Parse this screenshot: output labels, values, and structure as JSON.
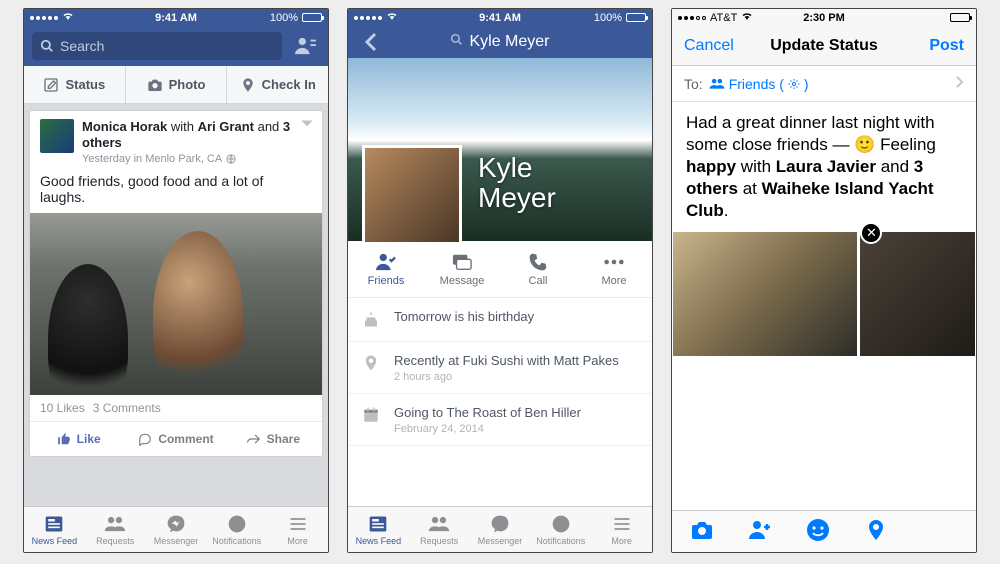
{
  "screen1": {
    "statusbar": {
      "time": "9:41 AM",
      "battery": "100%",
      "carrier": ""
    },
    "search_placeholder": "Search",
    "composer": {
      "status": "Status",
      "photo": "Photo",
      "checkin": "Check In"
    },
    "post": {
      "author": "Monica Horak",
      "with_word": "with",
      "tag1": "Ari Grant",
      "and_word": "and",
      "others": "3 others",
      "meta": "Yesterday in Menlo Park, CA",
      "body": "Good friends, good food and a lot of laughs.",
      "likes": "10 Likes",
      "comments": "3 Comments",
      "like": "Like",
      "comment": "Comment",
      "share": "Share"
    },
    "tabs": {
      "feed": "News Feed",
      "requests": "Requests",
      "messenger": "Messenger",
      "notifications": "Notifications",
      "more": "More"
    }
  },
  "screen2": {
    "statusbar": {
      "time": "9:41 AM",
      "battery": "100%"
    },
    "profile_name": "Kyle Meyer",
    "display_name_line1": "Kyle",
    "display_name_line2": "Meyer",
    "actions": {
      "friends": "Friends",
      "message": "Message",
      "call": "Call",
      "more": "More"
    },
    "info": {
      "birthday": "Tomorrow is his birthday",
      "recent": "Recently at Fuki Sushi with Matt Pakes",
      "recent_sub": "2 hours ago",
      "event": "Going to The Roast of Ben Hiller",
      "event_sub": "February 24, 2014"
    },
    "tabs": {
      "feed": "News Feed",
      "requests": "Requests",
      "messenger": "Messenger",
      "notifications": "Notifications",
      "more": "More"
    }
  },
  "screen3": {
    "statusbar": {
      "time": "2:30 PM",
      "carrier": "AT&T"
    },
    "nav": {
      "cancel": "Cancel",
      "title": "Update Status",
      "post": "Post"
    },
    "to_label": "To:",
    "audience": "Friends (",
    "audience_suffix": ")",
    "compose": {
      "p1": "Had a great dinner last night with some close friends — ",
      "feeling_word": "Feeling",
      "feeling": "happy",
      "with_word": "with",
      "tag1": "Laura Javier",
      "and_word": "and",
      "others": "3 others",
      "at_word": "at",
      "place": "Waiheke Island Yacht Club",
      "period": "."
    }
  }
}
